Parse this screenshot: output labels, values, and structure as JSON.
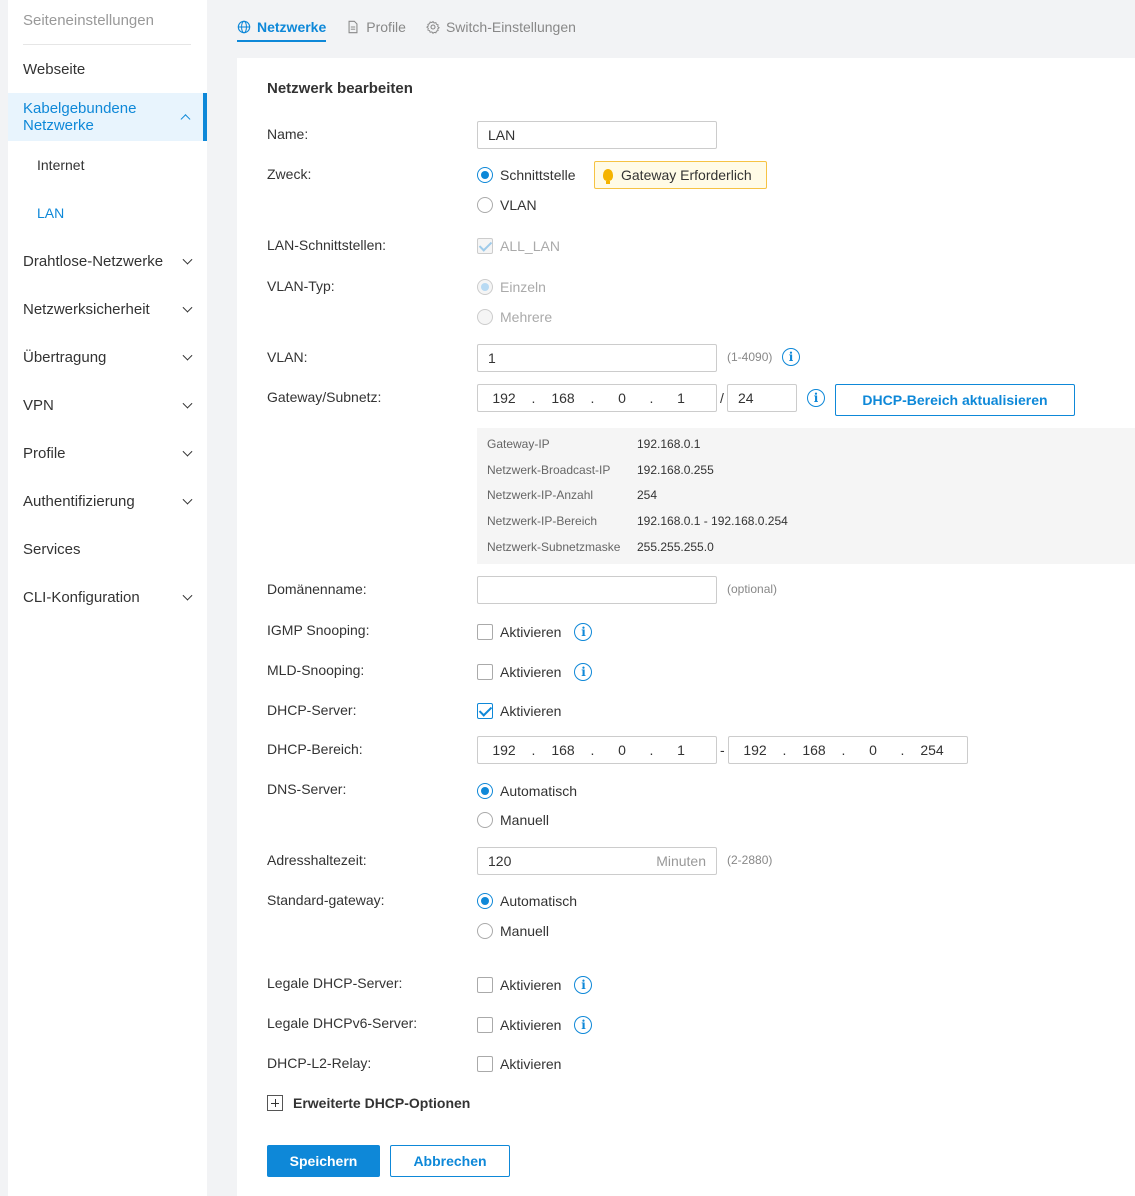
{
  "sidebar": {
    "header": "Seiteneinstellungen",
    "items": {
      "webseite": "Webseite",
      "kabel": "Kabelgebundene Netzwerke",
      "internet": "Internet",
      "lan": "LAN",
      "drahtlos": "Drahtlose-Netzwerke",
      "sicherheit": "Netzwerksicherheit",
      "uebertragung": "Übertragung",
      "vpn": "VPN",
      "profile": "Profile",
      "auth": "Authentifizierung",
      "services": "Services",
      "cli": "CLI-Konfiguration"
    }
  },
  "tabs": {
    "netzwerke": "Netzwerke",
    "profile": "Profile",
    "switch": "Switch-Einstellungen"
  },
  "form": {
    "title": "Netzwerk bearbeiten",
    "name": {
      "label": "Name:",
      "value": "LAN"
    },
    "zweck": {
      "label": "Zweck:",
      "opt_schnittstelle": "Schnittstelle",
      "opt_vlan": "VLAN",
      "selected": "Schnittstelle",
      "tag": "Gateway Erforderlich"
    },
    "lan_if": {
      "label": "LAN-Schnittstellen:",
      "value": "ALL_LAN",
      "checked": true
    },
    "vlan_typ": {
      "label": "VLAN-Typ:",
      "opt_einzeln": "Einzeln",
      "opt_mehrere": "Mehrere",
      "selected": "Einzeln"
    },
    "vlan": {
      "label": "VLAN:",
      "value": "1",
      "hint": "(1-4090)"
    },
    "gateway": {
      "label": "Gateway/Subnetz:",
      "ip": [
        "192",
        "168",
        "0",
        "1"
      ],
      "slash": "/",
      "mask": "24",
      "button": "DHCP-Bereich aktualisieren"
    },
    "info": {
      "gateway_ip_key": "Gateway-IP",
      "gateway_ip_val": "192.168.0.1",
      "broadcast_key": "Netzwerk-Broadcast-IP",
      "broadcast_val": "192.168.0.255",
      "count_key": "Netzwerk-IP-Anzahl",
      "count_val": "254",
      "range_key": "Netzwerk-IP-Bereich",
      "range_val": "192.168.0.1 - 192.168.0.254",
      "mask_key": "Netzwerk-Subnetzmaske",
      "mask_val": "255.255.255.0"
    },
    "domain": {
      "label": "Domänenname:",
      "value": "",
      "hint": "(optional)"
    },
    "igmp": {
      "label": "IGMP Snooping:",
      "check": "Aktivieren",
      "checked": false
    },
    "mld": {
      "label": "MLD-Snooping:",
      "check": "Aktivieren",
      "checked": false
    },
    "dhcp_server": {
      "label": "DHCP-Server:",
      "check": "Aktivieren",
      "checked": true
    },
    "dhcp_range": {
      "label": "DHCP-Bereich:",
      "start": [
        "192",
        "168",
        "0",
        "1"
      ],
      "dash": "-",
      "end": [
        "192",
        "168",
        "0",
        "254"
      ]
    },
    "dns": {
      "label": "DNS-Server:",
      "opt_auto": "Automatisch",
      "opt_manual": "Manuell",
      "selected": "Automatisch"
    },
    "lease": {
      "label": "Adresshaltezeit:",
      "value": "120",
      "unit": "Minuten",
      "hint": "(2-2880)"
    },
    "std_gw": {
      "label": "Standard-gateway:",
      "opt_auto": "Automatisch",
      "opt_manual": "Manuell",
      "selected": "Automatisch"
    },
    "legal_dhcp": {
      "label": "Legale DHCP-Server:",
      "check": "Aktivieren",
      "checked": false
    },
    "legal_dhcp6": {
      "label": "Legale DHCPv6-Server:",
      "check": "Aktivieren",
      "checked": false
    },
    "l2_relay": {
      "label": "DHCP-L2-Relay:",
      "check": "Aktivieren",
      "checked": false
    },
    "advanced": "Erweiterte DHCP-Optionen",
    "save": "Speichern",
    "cancel": "Abbrechen"
  },
  "colors": {
    "accent": "#0e88d8",
    "tag_border": "#f6c343",
    "tag_bg": "#fffbe6"
  }
}
